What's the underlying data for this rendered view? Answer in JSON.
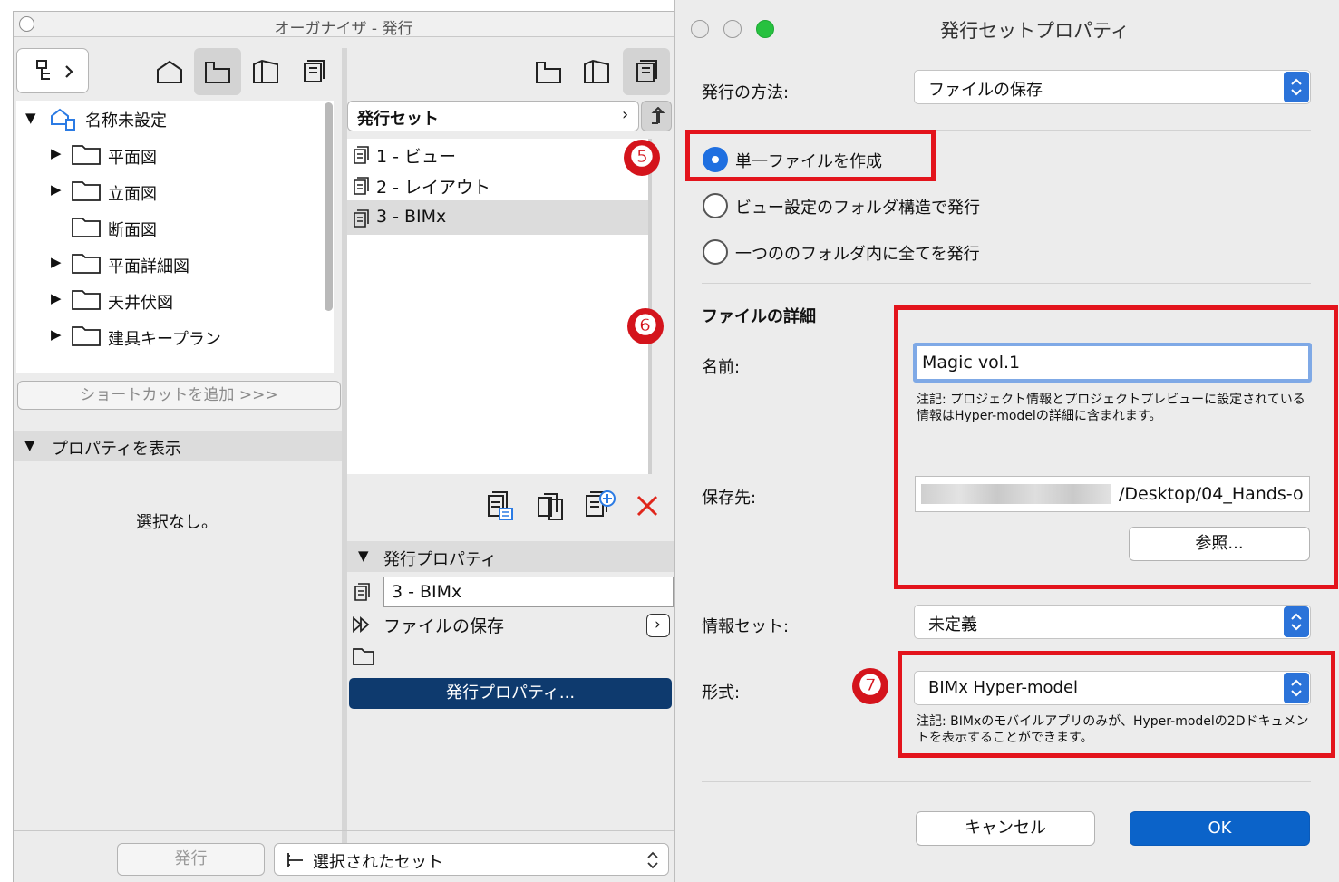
{
  "organizer": {
    "title": "オーガナイザ - 発行",
    "tree": {
      "root": "名称未設定",
      "items": [
        {
          "label": "平面図",
          "expandable": true
        },
        {
          "label": "立面図",
          "expandable": true
        },
        {
          "label": "断面図",
          "expandable": false
        },
        {
          "label": "平面詳細図",
          "expandable": true
        },
        {
          "label": "天井伏図",
          "expandable": true
        },
        {
          "label": "建具キープラン",
          "expandable": true
        }
      ]
    },
    "add_shortcut_label": "ショートカットを追加 >>>",
    "properties_header": "プロパティを表示",
    "no_selection": "選択なし。",
    "publish_set_dropdown": "発行セット",
    "sets": [
      {
        "label": "1 - ビュー",
        "selected": false
      },
      {
        "label": "2 - レイアウト",
        "selected": false
      },
      {
        "label": "3 - BIMx",
        "selected": true
      }
    ],
    "publish_properties_header": "発行プロパティ",
    "set_name_value": "3 - BIMx",
    "method_value": "ファイルの保存",
    "publish_properties_button": "発行プロパティ...",
    "publish_button": "発行",
    "selected_sets_label": "選択されたセット"
  },
  "dialog": {
    "title": "発行セットプロパティ",
    "method_label": "発行の方法:",
    "method_value": "ファイルの保存",
    "radios": [
      {
        "label": "単一ファイルを作成",
        "selected": true
      },
      {
        "label": "ビュー設定のフォルダ構造で発行",
        "selected": false
      },
      {
        "label": "一つののフォルダ内に全てを発行",
        "selected": false
      }
    ],
    "file_details_header": "ファイルの詳細",
    "name_label": "名前:",
    "name_value": "Magic vol.1",
    "name_note": "注記: プロジェクト情報とプロジェクトプレビューに設定されている情報はHyper-modelの詳細に含まれます。",
    "dest_label": "保存先:",
    "dest_value": "/Desktop/04_Hands-o",
    "browse_button": "参照...",
    "info_set_label": "情報セット:",
    "info_set_value": "未定義",
    "format_label": "形式:",
    "format_value": "BIMx Hyper-model",
    "format_note": "注記: BIMxのモバイルアプリのみが、Hyper-modelの2Dドキュメントを表示することができます。",
    "cancel_button": "キャンセル",
    "ok_button": "OK"
  },
  "annotations": [
    "❺",
    "❻",
    "❼"
  ],
  "colors": {
    "accent": "#1f6fe0",
    "highlight_red": "#e3141c",
    "publish_button_bg": "#0e3a6e",
    "ok_button_bg": "#0b63c9",
    "delete_icon": "#e0261b"
  }
}
